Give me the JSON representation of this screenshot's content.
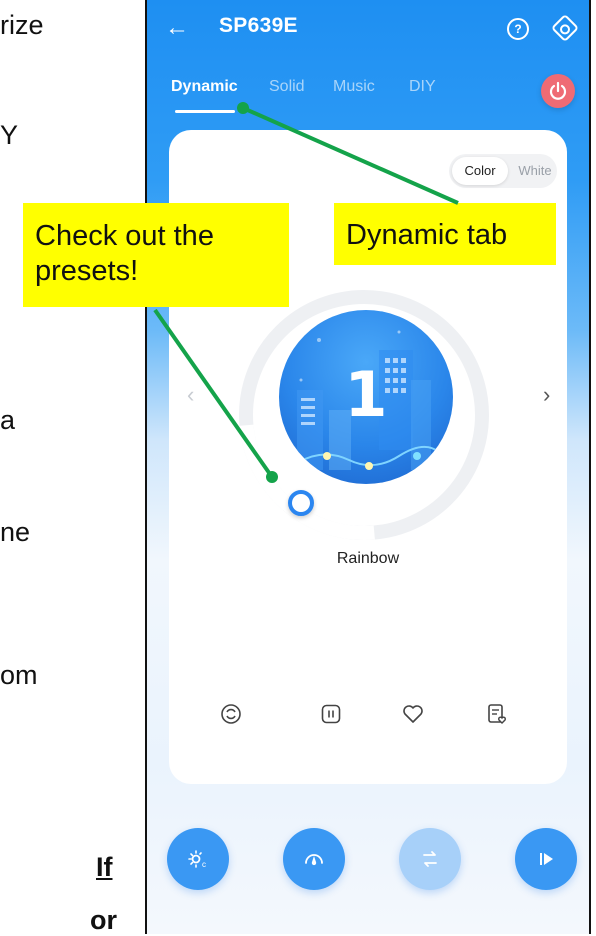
{
  "document_fragments": {
    "line1": "rize",
    "line2": "Y",
    "line3": "a",
    "line4": "ne",
    "line5": "om",
    "line6": "If",
    "line7": "or"
  },
  "app": {
    "device_name": "SP639E",
    "back_icon": "arrow-left-icon",
    "help_icon": "question-circle-icon",
    "settings_icon": "hexagon-settings-icon",
    "help_glyph": "?",
    "tabs": [
      {
        "label": "Dynamic",
        "active": true
      },
      {
        "label": "Solid",
        "active": false
      },
      {
        "label": "Music",
        "active": false
      },
      {
        "label": "DIY",
        "active": false
      }
    ],
    "power_icon": "power-icon",
    "power_color": "#ef6b74",
    "mode_toggle": {
      "color_label": "Color",
      "white_label": "White",
      "selected": "Color"
    },
    "preset": {
      "number": "1",
      "name": "Rainbow"
    },
    "prev_glyph": "‹",
    "next_glyph": "›",
    "actions": [
      "refresh-icon",
      "pause-icon",
      "heart-icon",
      "list-favorite-icon"
    ],
    "bottom_buttons": [
      "brightness-icon",
      "speed-icon",
      "transition-icon",
      "play-icon"
    ],
    "accent_color": "#2b8ef2"
  },
  "annotations": {
    "presets_callout": "Check out the presets!",
    "dynamic_callout": "Dynamic tab",
    "callout_color": "#ffff00",
    "arrow_color": "#14a34a"
  }
}
